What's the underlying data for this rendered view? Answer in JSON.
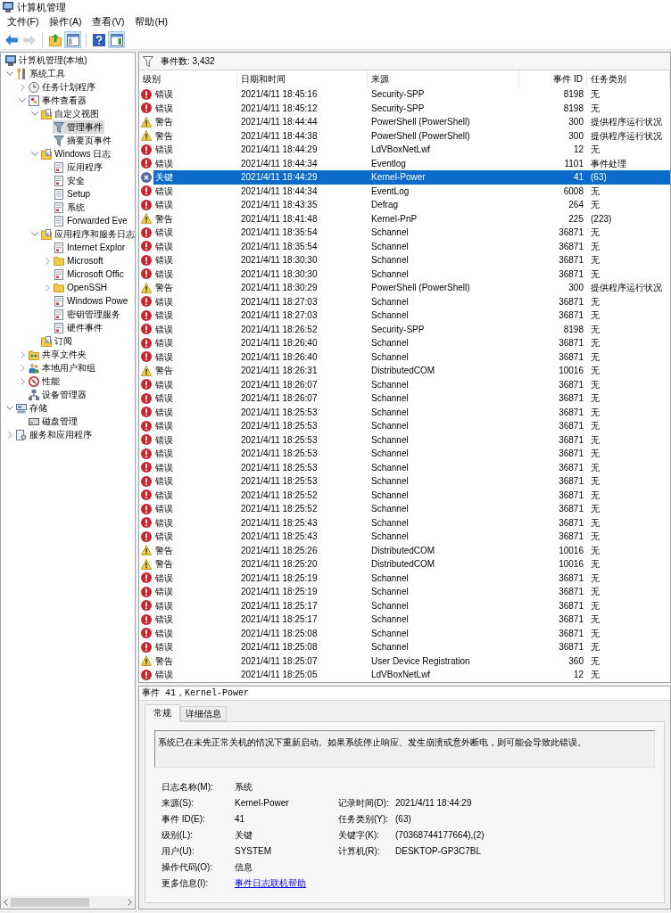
{
  "window": {
    "title": "计算机管理"
  },
  "menu": [
    "文件(F)",
    "操作(A)",
    "查看(V)",
    "帮助(H)"
  ],
  "toolbar": [
    [
      {
        "kind": "back",
        "disabled": false,
        "pressed": false
      },
      {
        "kind": "forward",
        "disabled": true,
        "pressed": false
      }
    ],
    [
      {
        "kind": "up",
        "disabled": false,
        "pressed": false
      },
      {
        "kind": "tree",
        "disabled": false,
        "pressed": true
      }
    ],
    [
      {
        "kind": "help",
        "disabled": false,
        "pressed": false
      },
      {
        "kind": "actions",
        "disabled": false,
        "pressed": true
      }
    ]
  ],
  "tree": [
    {
      "label": "计算机管理(本地)",
      "kind": "computer",
      "selected": false,
      "children": [
        {
          "label": "系统工具",
          "kind": "tools",
          "selected": false,
          "expanded": true,
          "children": [
            {
              "label": "任务计划程序",
              "kind": "clock",
              "selected": false,
              "expanded": false
            },
            {
              "label": "事件查看器",
              "kind": "viewer",
              "selected": false,
              "expanded": true,
              "children": [
                {
                  "label": "自定义视图",
                  "kind": "logfolder",
                  "selected": false,
                  "expanded": true,
                  "children": [
                    {
                      "label": "管理事件",
                      "kind": "filter",
                      "selected": true
                    },
                    {
                      "label": "摘要页事件",
                      "kind": "filter",
                      "selected": false
                    }
                  ]
                },
                {
                  "label": "Windows 日志",
                  "kind": "logfolder",
                  "selected": false,
                  "expanded": true,
                  "children": [
                    {
                      "label": "应用程序",
                      "kind": "log",
                      "selected": false
                    },
                    {
                      "label": "安全",
                      "kind": "log",
                      "selected": false
                    },
                    {
                      "label": "Setup",
                      "kind": "sheet",
                      "selected": false
                    },
                    {
                      "label": "系统",
                      "kind": "log",
                      "selected": false
                    },
                    {
                      "label": "Forwarded Eve",
                      "kind": "sheet",
                      "selected": false
                    }
                  ]
                },
                {
                  "label": "应用程序和服务日志",
                  "kind": "logfolder",
                  "selected": false,
                  "expanded": true,
                  "children": [
                    {
                      "label": "Internet Explor",
                      "kind": "log",
                      "selected": false
                    },
                    {
                      "label": "Microsoft",
                      "kind": "folder",
                      "selected": false,
                      "expanded": false
                    },
                    {
                      "label": "Microsoft Offic",
                      "kind": "log",
                      "selected": false
                    },
                    {
                      "label": "OpenSSH",
                      "kind": "folder",
                      "selected": false,
                      "expanded": false
                    },
                    {
                      "label": "Windows Powe",
                      "kind": "log",
                      "selected": false
                    },
                    {
                      "label": "密钥管理服务",
                      "kind": "log",
                      "selected": false
                    },
                    {
                      "label": "硬件事件",
                      "kind": "log",
                      "selected": false
                    }
                  ]
                },
                {
                  "label": "订阅",
                  "kind": "logfolder",
                  "selected": false
                }
              ]
            },
            {
              "label": "共享文件夹",
              "kind": "share",
              "selected": false,
              "expanded": false
            },
            {
              "label": "本地用户和组",
              "kind": "users",
              "selected": false,
              "expanded": false
            },
            {
              "label": "性能",
              "kind": "performance",
              "selected": false,
              "expanded": false
            },
            {
              "label": "设备管理器",
              "kind": "device",
              "selected": false
            }
          ]
        },
        {
          "label": "存储",
          "kind": "storage",
          "selected": false,
          "expanded": true,
          "children": [
            {
              "label": "磁盘管理",
              "kind": "disk",
              "selected": false
            }
          ]
        },
        {
          "label": "服务和应用程序",
          "kind": "services",
          "selected": false,
          "expanded": false
        }
      ]
    }
  ],
  "events": {
    "count_label": "事件数: 3,432",
    "columns": [
      "级别",
      "日期和时间",
      "来源",
      "事件 ID",
      "任务类别"
    ],
    "rows": [
      {
        "kind": "error",
        "severity": "错误",
        "date_time": "2021/4/11 18:45:16",
        "source": "Security-SPP",
        "event_id": "8198",
        "task_category": "无",
        "selected": false
      },
      {
        "kind": "error",
        "severity": "错误",
        "date_time": "2021/4/11 18:45:12",
        "source": "Security-SPP",
        "event_id": "8198",
        "task_category": "无",
        "selected": false
      },
      {
        "kind": "warning",
        "severity": "警告",
        "date_time": "2021/4/11 18:44:44",
        "source": "PowerShell (PowerShell)",
        "event_id": "300",
        "task_category": "提供程序运行状况",
        "selected": false
      },
      {
        "kind": "warning",
        "severity": "警告",
        "date_time": "2021/4/11 18:44:38",
        "source": "PowerShell (PowerShell)",
        "event_id": "300",
        "task_category": "提供程序运行状况",
        "selected": false
      },
      {
        "kind": "error",
        "severity": "错误",
        "date_time": "2021/4/11 18:44:29",
        "source": "LdVBoxNetLwf",
        "event_id": "12",
        "task_category": "无",
        "selected": false
      },
      {
        "kind": "error",
        "severity": "错误",
        "date_time": "2021/4/11 18:44:34",
        "source": "Eventlog",
        "event_id": "1101",
        "task_category": "事件处理",
        "selected": false
      },
      {
        "kind": "critical",
        "severity": "关键",
        "date_time": "2021/4/11 18:44:29",
        "source": "Kernel-Power",
        "event_id": "41",
        "task_category": "(63)",
        "selected": true
      },
      {
        "kind": "error",
        "severity": "错误",
        "date_time": "2021/4/11 18:44:34",
        "source": "EventLog",
        "event_id": "6008",
        "task_category": "无",
        "selected": false
      },
      {
        "kind": "error",
        "severity": "错误",
        "date_time": "2021/4/11 18:43:35",
        "source": "Defrag",
        "event_id": "264",
        "task_category": "无",
        "selected": false
      },
      {
        "kind": "warning",
        "severity": "警告",
        "date_time": "2021/4/11 18:41:48",
        "source": "Kernel-PnP",
        "event_id": "225",
        "task_category": "(223)",
        "selected": false
      },
      {
        "kind": "error",
        "severity": "错误",
        "date_time": "2021/4/11 18:35:54",
        "source": "Schannel",
        "event_id": "36871",
        "task_category": "无",
        "selected": false
      },
      {
        "kind": "error",
        "severity": "错误",
        "date_time": "2021/4/11 18:35:54",
        "source": "Schannel",
        "event_id": "36871",
        "task_category": "无",
        "selected": false
      },
      {
        "kind": "error",
        "severity": "错误",
        "date_time": "2021/4/11 18:30:30",
        "source": "Schannel",
        "event_id": "36871",
        "task_category": "无",
        "selected": false
      },
      {
        "kind": "error",
        "severity": "错误",
        "date_time": "2021/4/11 18:30:30",
        "source": "Schannel",
        "event_id": "36871",
        "task_category": "无",
        "selected": false
      },
      {
        "kind": "warning",
        "severity": "警告",
        "date_time": "2021/4/11 18:30:29",
        "source": "PowerShell (PowerShell)",
        "event_id": "300",
        "task_category": "提供程序运行状况",
        "selected": false
      },
      {
        "kind": "error",
        "severity": "错误",
        "date_time": "2021/4/11 18:27:03",
        "source": "Schannel",
        "event_id": "36871",
        "task_category": "无",
        "selected": false
      },
      {
        "kind": "error",
        "severity": "错误",
        "date_time": "2021/4/11 18:27:03",
        "source": "Schannel",
        "event_id": "36871",
        "task_category": "无",
        "selected": false
      },
      {
        "kind": "error",
        "severity": "错误",
        "date_time": "2021/4/11 18:26:52",
        "source": "Security-SPP",
        "event_id": "8198",
        "task_category": "无",
        "selected": false
      },
      {
        "kind": "error",
        "severity": "错误",
        "date_time": "2021/4/11 18:26:40",
        "source": "Schannel",
        "event_id": "36871",
        "task_category": "无",
        "selected": false
      },
      {
        "kind": "error",
        "severity": "错误",
        "date_time": "2021/4/11 18:26:40",
        "source": "Schannel",
        "event_id": "36871",
        "task_category": "无",
        "selected": false
      },
      {
        "kind": "warning",
        "severity": "警告",
        "date_time": "2021/4/11 18:26:31",
        "source": "DistributedCOM",
        "event_id": "10016",
        "task_category": "无",
        "selected": false
      },
      {
        "kind": "error",
        "severity": "错误",
        "date_time": "2021/4/11 18:26:07",
        "source": "Schannel",
        "event_id": "36871",
        "task_category": "无",
        "selected": false
      },
      {
        "kind": "error",
        "severity": "错误",
        "date_time": "2021/4/11 18:26:07",
        "source": "Schannel",
        "event_id": "36871",
        "task_category": "无",
        "selected": false
      },
      {
        "kind": "error",
        "severity": "错误",
        "date_time": "2021/4/11 18:25:53",
        "source": "Schannel",
        "event_id": "36871",
        "task_category": "无",
        "selected": false
      },
      {
        "kind": "error",
        "severity": "错误",
        "date_time": "2021/4/11 18:25:53",
        "source": "Schannel",
        "event_id": "36871",
        "task_category": "无",
        "selected": false
      },
      {
        "kind": "error",
        "severity": "错误",
        "date_time": "2021/4/11 18:25:53",
        "source": "Schannel",
        "event_id": "36871",
        "task_category": "无",
        "selected": false
      },
      {
        "kind": "error",
        "severity": "错误",
        "date_time": "2021/4/11 18:25:53",
        "source": "Schannel",
        "event_id": "36871",
        "task_category": "无",
        "selected": false
      },
      {
        "kind": "error",
        "severity": "错误",
        "date_time": "2021/4/11 18:25:53",
        "source": "Schannel",
        "event_id": "36871",
        "task_category": "无",
        "selected": false
      },
      {
        "kind": "error",
        "severity": "错误",
        "date_time": "2021/4/11 18:25:53",
        "source": "Schannel",
        "event_id": "36871",
        "task_category": "无",
        "selected": false
      },
      {
        "kind": "error",
        "severity": "错误",
        "date_time": "2021/4/11 18:25:52",
        "source": "Schannel",
        "event_id": "36871",
        "task_category": "无",
        "selected": false
      },
      {
        "kind": "error",
        "severity": "错误",
        "date_time": "2021/4/11 18:25:52",
        "source": "Schannel",
        "event_id": "36871",
        "task_category": "无",
        "selected": false
      },
      {
        "kind": "error",
        "severity": "错误",
        "date_time": "2021/4/11 18:25:43",
        "source": "Schannel",
        "event_id": "36871",
        "task_category": "无",
        "selected": false
      },
      {
        "kind": "error",
        "severity": "错误",
        "date_time": "2021/4/11 18:25:43",
        "source": "Schannel",
        "event_id": "36871",
        "task_category": "无",
        "selected": false
      },
      {
        "kind": "warning",
        "severity": "警告",
        "date_time": "2021/4/11 18:25:26",
        "source": "DistributedCOM",
        "event_id": "10016",
        "task_category": "无",
        "selected": false
      },
      {
        "kind": "warning",
        "severity": "警告",
        "date_time": "2021/4/11 18:25:20",
        "source": "DistributedCOM",
        "event_id": "10016",
        "task_category": "无",
        "selected": false
      },
      {
        "kind": "error",
        "severity": "错误",
        "date_time": "2021/4/11 18:25:19",
        "source": "Schannel",
        "event_id": "36871",
        "task_category": "无",
        "selected": false
      },
      {
        "kind": "error",
        "severity": "错误",
        "date_time": "2021/4/11 18:25:19",
        "source": "Schannel",
        "event_id": "36871",
        "task_category": "无",
        "selected": false
      },
      {
        "kind": "error",
        "severity": "错误",
        "date_time": "2021/4/11 18:25:17",
        "source": "Schannel",
        "event_id": "36871",
        "task_category": "无",
        "selected": false
      },
      {
        "kind": "error",
        "severity": "错误",
        "date_time": "2021/4/11 18:25:17",
        "source": "Schannel",
        "event_id": "36871",
        "task_category": "无",
        "selected": false
      },
      {
        "kind": "error",
        "severity": "错误",
        "date_time": "2021/4/11 18:25:08",
        "source": "Schannel",
        "event_id": "36871",
        "task_category": "无",
        "selected": false
      },
      {
        "kind": "error",
        "severity": "错误",
        "date_time": "2021/4/11 18:25:08",
        "source": "Schannel",
        "event_id": "36871",
        "task_category": "无",
        "selected": false
      },
      {
        "kind": "warning",
        "severity": "警告",
        "date_time": "2021/4/11 18:25:07",
        "source": "User Device Registration",
        "event_id": "360",
        "task_category": "无",
        "selected": false
      },
      {
        "kind": "error",
        "severity": "错误",
        "date_time": "2021/4/11 18:25:05",
        "source": "LdVBoxNetLwf",
        "event_id": "12",
        "task_category": "无",
        "selected": false
      }
    ]
  },
  "details": {
    "title": "事件 41，Kernel-Power",
    "tabs": [
      {
        "label": "常规",
        "selected": true
      },
      {
        "label": "详细信息",
        "selected": false
      }
    ],
    "description": "系统已在未先正常关机的情况下重新启动。如果系统停止响应、发生崩溃或意外断电，则可能会导致此错误。",
    "fields": [
      [
        {
          "label": "日志名称(M):",
          "value": "系统",
          "kind": "text"
        }
      ],
      [
        {
          "label": "来源(S):",
          "value": "Kernel-Power",
          "kind": "text"
        },
        {
          "label": "记录时间(D):",
          "value": "2021/4/11 18:44:29",
          "kind": "text"
        }
      ],
      [
        {
          "label": "事件 ID(E):",
          "value": "41",
          "kind": "text"
        },
        {
          "label": "任务类别(Y):",
          "value": "(63)",
          "kind": "text"
        }
      ],
      [
        {
          "label": "级别(L):",
          "value": "关键",
          "kind": "text"
        },
        {
          "label": "关键字(K):",
          "value": "(70368744177664),(2)",
          "kind": "text"
        }
      ],
      [
        {
          "label": "用户(U):",
          "value": "SYSTEM",
          "kind": "text"
        },
        {
          "label": "计算机(R):",
          "value": "DESKTOP-GP3C7BL",
          "kind": "text"
        }
      ],
      [
        {
          "label": "操作代码(O):",
          "value": "信息",
          "kind": "text"
        }
      ],
      [
        {
          "label": "更多信息(I):",
          "value": "事件日志联机帮助",
          "kind": "link"
        }
      ]
    ]
  }
}
